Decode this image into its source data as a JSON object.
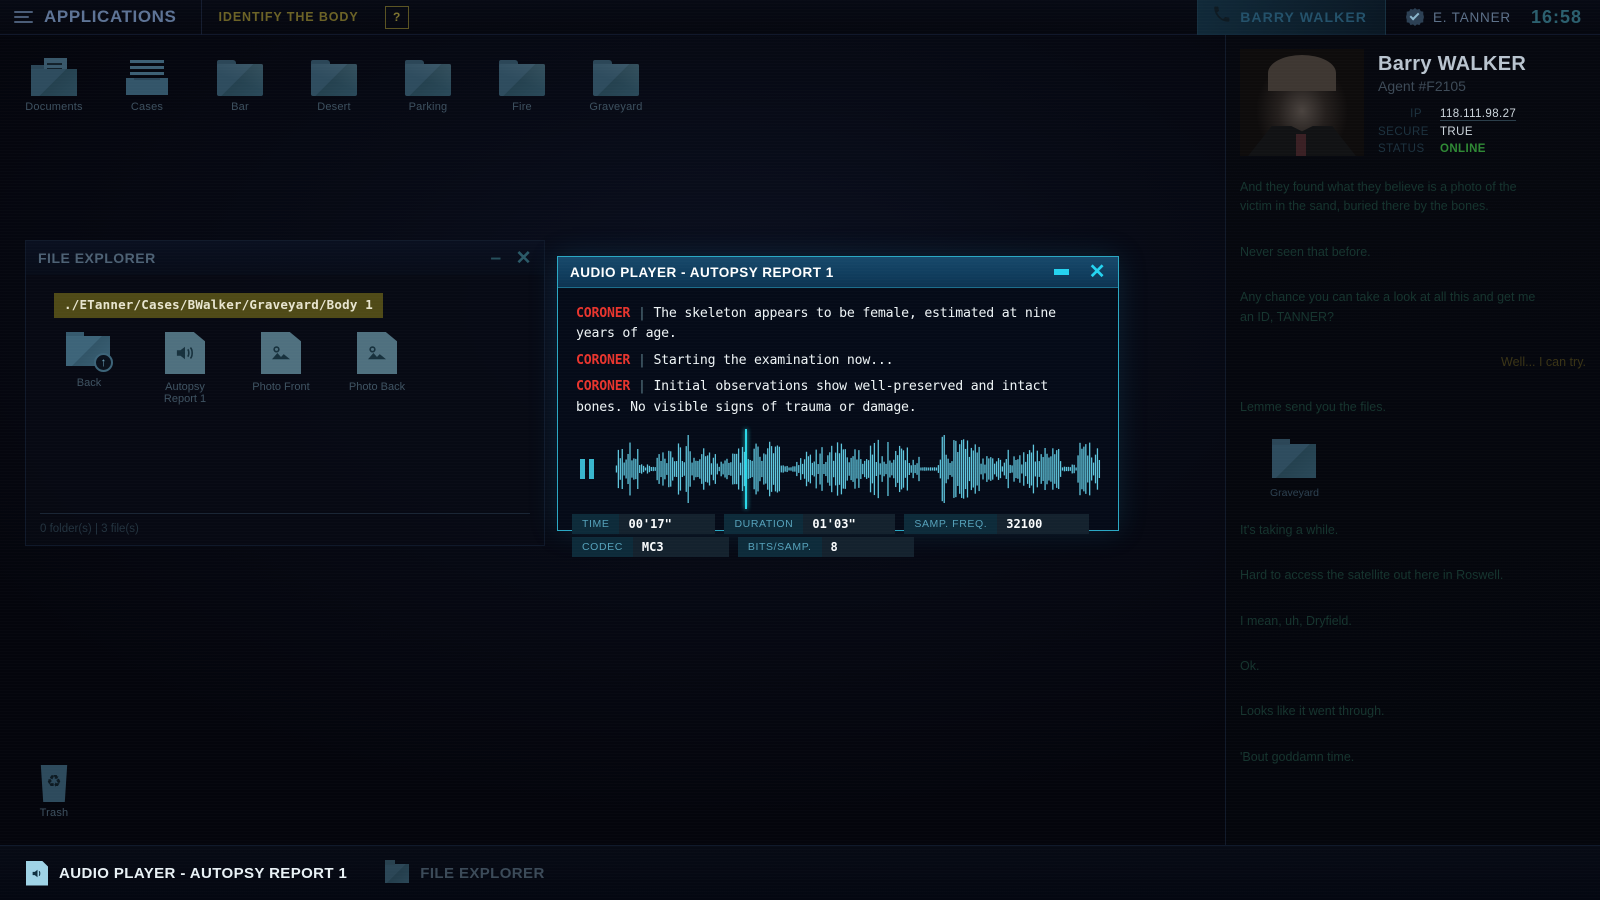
{
  "topbar": {
    "apps_label": "Applications",
    "mission_label": "Identify the body",
    "help_label": "?",
    "contact_name": "BARRY WALKER",
    "contact_icon": "phone-icon",
    "user_name": "E. TANNER",
    "user_icon": "verified-badge-icon",
    "clock": "16:58"
  },
  "desktop": {
    "icons": [
      {
        "label": "Documents",
        "type": "documents"
      },
      {
        "label": "Cases",
        "type": "cases"
      },
      {
        "label": "Bar",
        "type": "folder"
      },
      {
        "label": "Desert",
        "type": "folder"
      },
      {
        "label": "Parking",
        "type": "folder"
      },
      {
        "label": "Fire",
        "type": "folder"
      },
      {
        "label": "Graveyard",
        "type": "folder"
      }
    ],
    "trash": {
      "label": "Trash"
    }
  },
  "file_explorer": {
    "title": "FILE EXPLORER",
    "minimize": "–",
    "close": "✕",
    "path": "./ETanner/Cases/BWalker/Graveyard/Body 1",
    "items": [
      {
        "label": "Back",
        "type": "back-folder"
      },
      {
        "label": "Autopsy Report 1",
        "type": "audio-file",
        "glyph": "🔊"
      },
      {
        "label": "Photo Front",
        "type": "image-file",
        "glyph": "🖼"
      },
      {
        "label": "Photo Back",
        "type": "image-file",
        "glyph": "🖼"
      }
    ],
    "status": "0 folder(s)  |  3 file(s)"
  },
  "audio_player": {
    "title": "AUDIO PLAYER - AUTOPSY REPORT 1",
    "minimize": "–",
    "close": "✕",
    "speaker": "CORONER",
    "separator": "|",
    "transcript": [
      "The skeleton appears to be female, estimated at nine years of age.",
      "Starting the examination now...",
      "Initial observations show well-preserved and intact bones. No visible signs of trauma or damage."
    ],
    "playback_state": "paused",
    "playhead_percent": 27,
    "fields": [
      {
        "label": "TIME",
        "value": "00'17\""
      },
      {
        "label": "DURATION",
        "value": "01'03\""
      },
      {
        "label": "SAMP. FREQ.",
        "value": "32100"
      },
      {
        "label": "CODEC",
        "value": "MC3"
      },
      {
        "label": "BITS/SAMP.",
        "value": "8"
      }
    ]
  },
  "sidebar": {
    "profile": {
      "name": "Barry WALKER",
      "role": "Agent #F2105",
      "stats": [
        {
          "key": "IP",
          "value": "118.111.98.27"
        },
        {
          "key": "SECURE",
          "value": "TRUE"
        },
        {
          "key": "STATUS",
          "value": "ONLINE"
        }
      ]
    },
    "messages": [
      {
        "from": "them",
        "text": "And they found what they believe is a photo of the victim in the sand, buried there by the bones."
      },
      {
        "from": "them",
        "text": "Never seen that before."
      },
      {
        "from": "them",
        "text": "Any chance you can take a look at all this and get me an ID, TANNER?"
      },
      {
        "from": "me",
        "text": "Well... I can try."
      },
      {
        "from": "them",
        "text": "Lemme send you the files."
      },
      {
        "from": "them",
        "attachment": "Graveyard"
      },
      {
        "from": "them",
        "text": "It's taking a while."
      },
      {
        "from": "them",
        "text": "Hard to access the satellite out here in Roswell."
      },
      {
        "from": "them",
        "text": "I mean, uh, Dryfield."
      },
      {
        "from": "me",
        "text": "Ok."
      },
      {
        "from": "them",
        "text": "Looks like it went through."
      },
      {
        "from": "me",
        "text": "'Bout goddamn time."
      }
    ]
  },
  "taskbar": {
    "items": [
      {
        "label": "AUDIO PLAYER - AUTOPSY REPORT 1",
        "state": "active",
        "icon": "audio-file-icon"
      },
      {
        "label": "FILE EXPLORER",
        "state": "inactive",
        "icon": "folder-icon"
      }
    ]
  },
  "colors": {
    "accent_cyan": "#25d3f0",
    "mission_olive": "#6b6226",
    "online_green": "#2f8a35",
    "speaker_red": "#e8352e",
    "path_highlight": "#4f4a17"
  }
}
